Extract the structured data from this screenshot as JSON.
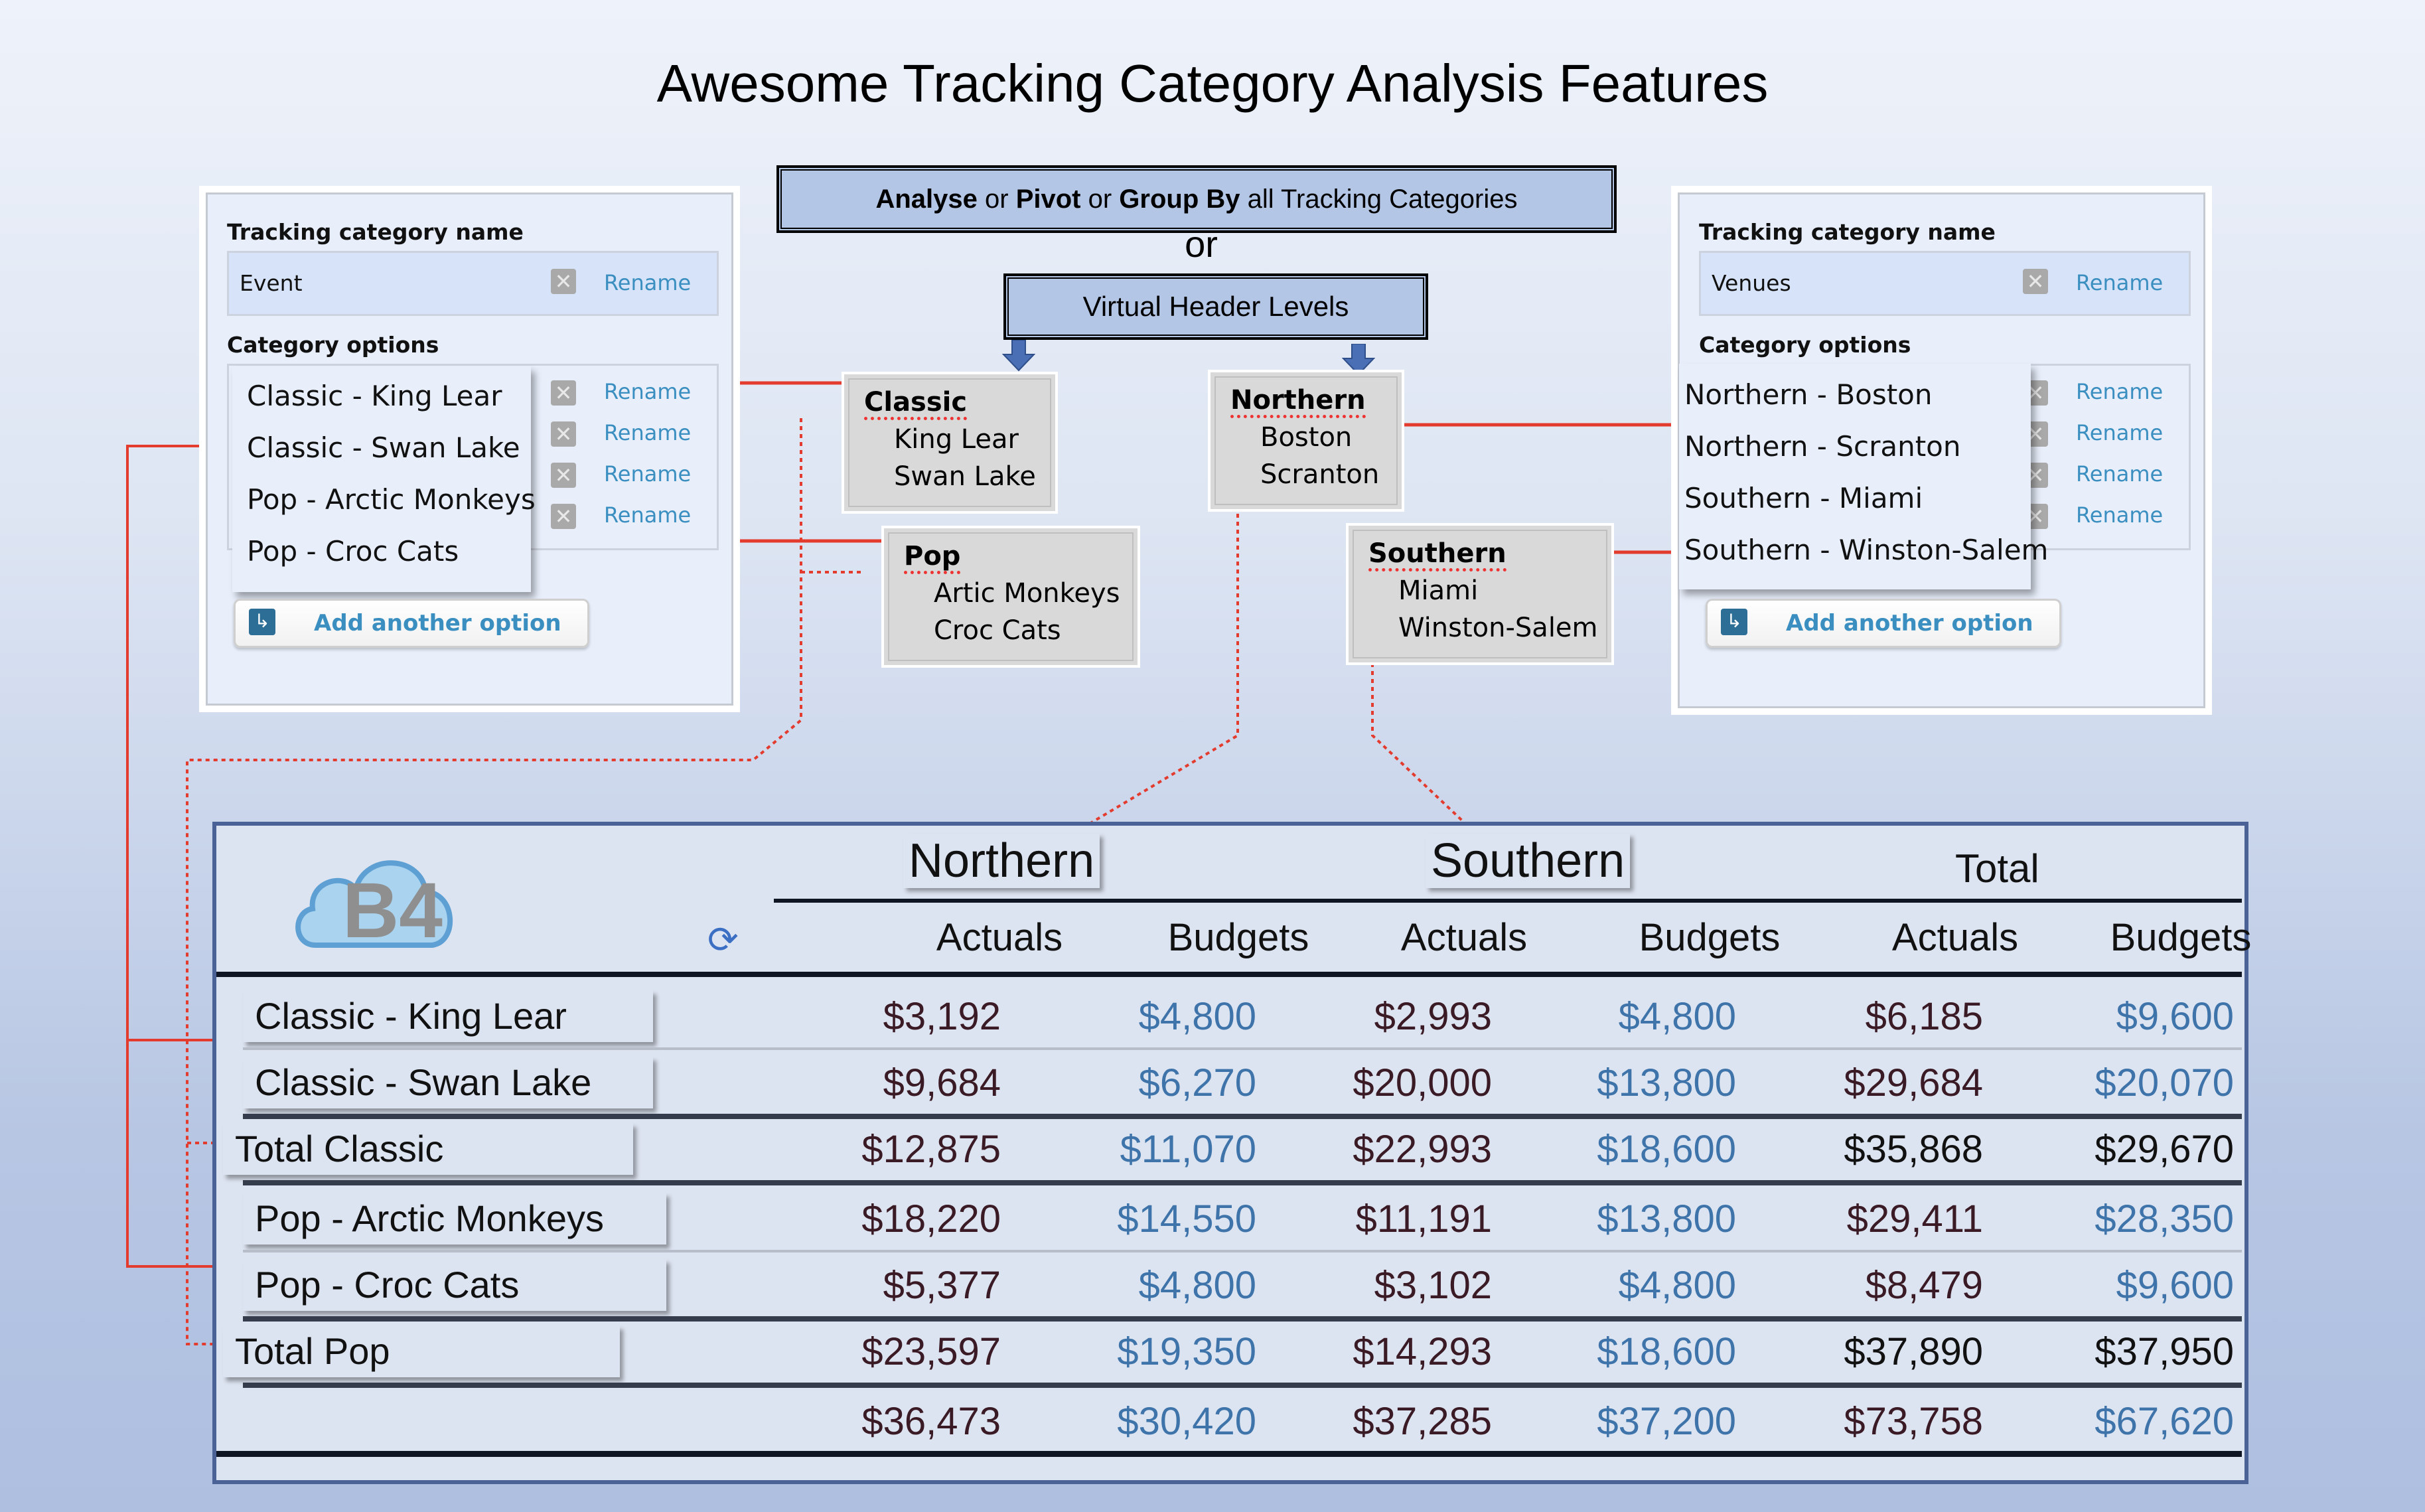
{
  "title": "Awesome Tracking Category Analysis Features",
  "center": {
    "analyse_box": {
      "parts": [
        {
          "text": "Analyse",
          "bold": true
        },
        {
          "text": " or ",
          "bold": false
        },
        {
          "text": "Pivot",
          "bold": true
        },
        {
          "text": " or ",
          "bold": false
        },
        {
          "text": "Group By",
          "bold": true
        },
        {
          "text": " all Tracking Categories",
          "bold": false
        }
      ]
    },
    "or_word": "or",
    "virtual_box": "Virtual Header Levels"
  },
  "left_panel": {
    "name_label": "Tracking category name",
    "name_value": "Event",
    "rename_label": "Rename",
    "options_label": "Category options",
    "options": [
      "Classic - King Lear",
      "Classic - Swan Lake",
      "Pop - Arctic Monkeys",
      "Pop - Croc Cats"
    ],
    "add_label": "Add another option"
  },
  "right_panel": {
    "name_label": "Tracking category name",
    "name_value": "Venues",
    "rename_label": "Rename",
    "options_label": "Category options",
    "options": [
      "Northern - Boston",
      "Northern - Scranton",
      "Southern - Miami",
      "Southern - Winston-Salem"
    ],
    "add_label": "Add another option"
  },
  "groups": {
    "classic": {
      "head": "Classic",
      "items": [
        "King Lear",
        "Swan Lake"
      ]
    },
    "pop": {
      "head": "Pop",
      "items": [
        "Artic Monkeys",
        "Croc Cats"
      ]
    },
    "northern": {
      "head": "Northern",
      "items": [
        "Boston",
        "Scranton"
      ]
    },
    "southern": {
      "head": "Southern",
      "items": [
        "Miami",
        "Winston-Salem"
      ]
    }
  },
  "report": {
    "logo_text": "B4",
    "top_headers": [
      "Northern",
      "Southern",
      "Total"
    ],
    "col_headers": [
      "Actuals",
      "Budgets",
      "Actuals",
      "Budgets",
      "Actuals",
      "Budgets"
    ],
    "rows": [
      {
        "label": "Classic - King Lear",
        "type": "item",
        "values": [
          "$3,192",
          "$4,800",
          "$2,993",
          "$4,800",
          "$6,185",
          "$9,600"
        ]
      },
      {
        "label": "Classic - Swan Lake",
        "type": "item",
        "values": [
          "$9,684",
          "$6,270",
          "$20,000",
          "$13,800",
          "$29,684",
          "$20,070"
        ]
      },
      {
        "label": "Total Classic",
        "type": "subtotal",
        "values": [
          "$12,875",
          "$11,070",
          "$22,993",
          "$18,600",
          "$35,868",
          "$29,670"
        ]
      },
      {
        "label": "Pop - Arctic Monkeys",
        "type": "item",
        "values": [
          "$18,220",
          "$14,550",
          "$11,191",
          "$13,800",
          "$29,411",
          "$28,350"
        ]
      },
      {
        "label": "Pop - Croc Cats",
        "type": "item",
        "values": [
          "$5,377",
          "$4,800",
          "$3,102",
          "$4,800",
          "$8,479",
          "$9,600"
        ]
      },
      {
        "label": "Total Pop",
        "type": "subtotal",
        "values": [
          "$23,597",
          "$19,350",
          "$14,293",
          "$18,600",
          "$37,890",
          "$37,950"
        ]
      },
      {
        "label": "",
        "type": "grandtotal",
        "values": [
          "$36,473",
          "$30,420",
          "$37,285",
          "$37,200",
          "$73,758",
          "$67,620"
        ]
      }
    ],
    "colors": {
      "actuals": "#3a1a24",
      "budgets": "#3e74aa",
      "total": "#111111",
      "connector": "#e33b2e"
    }
  }
}
